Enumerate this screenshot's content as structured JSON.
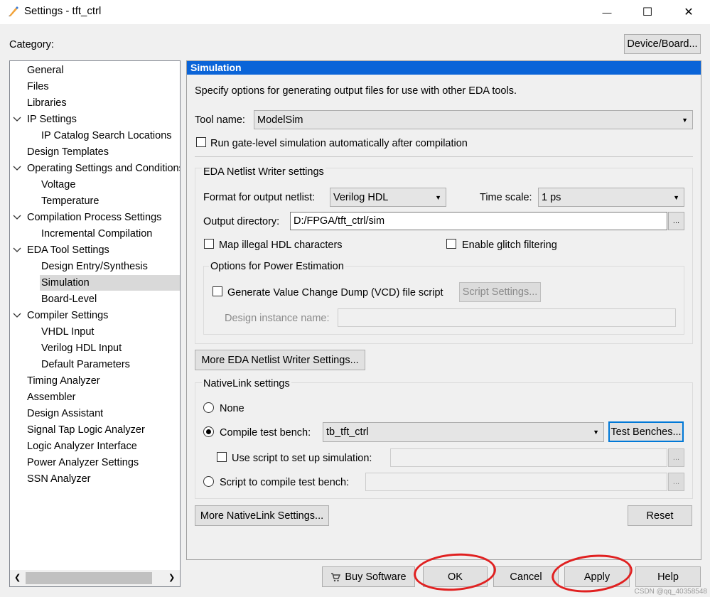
{
  "window": {
    "title": "Settings - tft_ctrl",
    "minimize_glyph": "—",
    "maximize_glyph": "☐",
    "close_glyph": "✕"
  },
  "category_label": "Category:",
  "device_board_button": "Device/Board...",
  "tree": [
    {
      "label": "General",
      "indent": 0
    },
    {
      "label": "Files",
      "indent": 0
    },
    {
      "label": "Libraries",
      "indent": 0
    },
    {
      "label": "IP Settings",
      "indent": 0,
      "expanded": true
    },
    {
      "label": "IP Catalog Search Locations",
      "indent": 1
    },
    {
      "label": "Design Templates",
      "indent": 0
    },
    {
      "label": "Operating Settings and Conditions",
      "indent": 0,
      "expanded": true
    },
    {
      "label": "Voltage",
      "indent": 1
    },
    {
      "label": "Temperature",
      "indent": 1
    },
    {
      "label": "Compilation Process Settings",
      "indent": 0,
      "expanded": true
    },
    {
      "label": "Incremental Compilation",
      "indent": 1
    },
    {
      "label": "EDA Tool Settings",
      "indent": 0,
      "expanded": true
    },
    {
      "label": "Design Entry/Synthesis",
      "indent": 1
    },
    {
      "label": "Simulation",
      "indent": 1,
      "selected": true
    },
    {
      "label": "Board-Level",
      "indent": 1
    },
    {
      "label": "Compiler Settings",
      "indent": 0,
      "expanded": true
    },
    {
      "label": "VHDL Input",
      "indent": 1
    },
    {
      "label": "Verilog HDL Input",
      "indent": 1
    },
    {
      "label": "Default Parameters",
      "indent": 1
    },
    {
      "label": "Timing Analyzer",
      "indent": 0
    },
    {
      "label": "Assembler",
      "indent": 0
    },
    {
      "label": "Design Assistant",
      "indent": 0
    },
    {
      "label": "Signal Tap Logic Analyzer",
      "indent": 0
    },
    {
      "label": "Logic Analyzer Interface",
      "indent": 0
    },
    {
      "label": "Power Analyzer Settings",
      "indent": 0
    },
    {
      "label": "SSN Analyzer",
      "indent": 0
    }
  ],
  "panel": {
    "header": "Simulation",
    "description": "Specify options for generating output files for use with other EDA tools.",
    "tool_name_label": "Tool name:",
    "tool_name_value": "ModelSim",
    "run_gate_level_label": "Run gate-level simulation automatically after compilation",
    "run_gate_level_checked": false,
    "netlist_group_title": "EDA Netlist Writer settings",
    "format_label": "Format for output netlist:",
    "format_value": "Verilog HDL",
    "timescale_label": "Time scale:",
    "timescale_value": "1 ps",
    "output_dir_label": "Output directory:",
    "output_dir_value": "D:/FPGA/tft_ctrl/sim",
    "browse_label": "...",
    "map_illegal_label": "Map illegal HDL characters",
    "map_illegal_checked": false,
    "glitch_label": "Enable glitch filtering",
    "glitch_checked": false,
    "power_group_title": "Options for Power Estimation",
    "vcd_label": "Generate Value Change Dump (VCD) file script",
    "vcd_checked": false,
    "script_settings_button": "Script Settings...",
    "design_instance_label": "Design instance name:",
    "design_instance_value": "",
    "more_netlist_button": "More EDA Netlist Writer Settings...",
    "nativelink_group_title": "NativeLink settings",
    "none_label": "None",
    "compile_tb_label": "Compile test bench:",
    "compile_tb_value": "tb_tft_ctrl",
    "test_benches_button": "Test Benches...",
    "use_script_label": "Use script to set up simulation:",
    "use_script_value": "",
    "script_compile_label": "Script to compile test bench:",
    "script_compile_value": "",
    "selected_radio": "compile_tb",
    "more_nativelink_button": "More NativeLink Settings...",
    "reset_button": "Reset"
  },
  "footer": {
    "buy_software": "Buy Software",
    "ok": "OK",
    "cancel": "Cancel",
    "apply": "Apply",
    "help": "Help"
  },
  "watermark": "CSDN @qq_40358548",
  "colors": {
    "panel_header_bg": "#0a64d8",
    "annotation_red": "#e02020",
    "focus_border": "#0078d7"
  }
}
